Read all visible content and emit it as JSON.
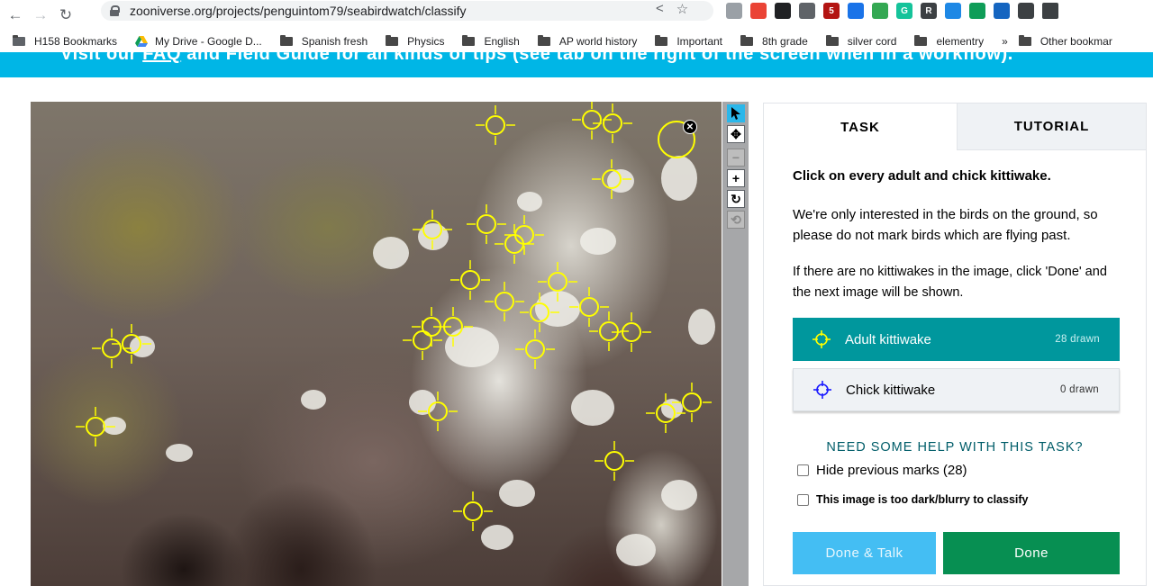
{
  "browser": {
    "url": "zooniverse.org/projects/penguintom79/seabirdwatch/classify",
    "extensions": [
      {
        "icon": "ext-gray-icon",
        "color": "#9aa0a6",
        "text": ""
      },
      {
        "icon": "ext-red-icon",
        "color": "#ea4335",
        "text": ""
      },
      {
        "icon": "ext-black-icon",
        "color": "#202124",
        "text": ""
      },
      {
        "icon": "ext-gray2-icon",
        "color": "#5f6368",
        "text": ""
      },
      {
        "icon": "ext-badge-icon",
        "color": "#b31412",
        "text": "5"
      },
      {
        "icon": "ext-blue-icon",
        "color": "#1a73e8",
        "text": ""
      },
      {
        "icon": "ext-green-icon",
        "color": "#34a853",
        "text": ""
      },
      {
        "icon": "ext-grammarly-icon",
        "color": "#15c39a",
        "text": "G"
      },
      {
        "icon": "ext-r-icon",
        "color": "#3c4043",
        "text": "R"
      },
      {
        "icon": "ext-cloud-icon",
        "color": "#1e88e5",
        "text": ""
      },
      {
        "icon": "ext-lp-icon",
        "color": "#0f9d58",
        "text": ""
      },
      {
        "icon": "ext-pin-icon",
        "color": "#1565c0",
        "text": ""
      }
    ]
  },
  "bookmarks": {
    "first": "H158 Bookmarks",
    "drive": "My Drive - Google D...",
    "folders": [
      "Spanish fresh",
      "Physics",
      "English",
      "AP world history",
      "Important",
      "8th grade",
      "silver cord",
      "elementry"
    ],
    "overflow": "»",
    "other": "Other bookmar"
  },
  "banner": {
    "pre": "Visit our ",
    "faq": "FAQ",
    "post": " and Field Guide for all kinds of tips (see tab on the right of the screen when in a workflow)."
  },
  "task_panel": {
    "tab_task": "TASK",
    "tab_tutorial": "TUTORIAL",
    "question": "Click on every adult and chick kittiwake.",
    "instructions_1": "We're only interested in the birds on the ground, so please do not mark birds which are flying past.",
    "instructions_2": "If there are no kittiwakes in the image, click 'Done' and the next image will be shown.",
    "tools": [
      {
        "label": "Adult kittiwake",
        "count": "28 drawn",
        "color": "#00979d"
      },
      {
        "label": "Chick kittiwake",
        "count": "0 drawn",
        "color": "#eff2f5"
      }
    ],
    "help_link": "NEED SOME HELP WITH THIS TASK?",
    "hide_marks": "Hide previous marks (28)",
    "too_dark": "This image is too dark/blurry to classify",
    "btn_talk": "Done & Talk",
    "btn_done": "Done"
  },
  "viewer": {
    "mark_color": "#ffff00"
  }
}
